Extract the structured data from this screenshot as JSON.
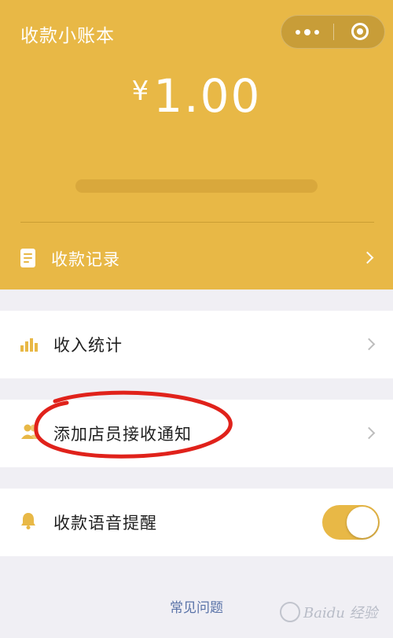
{
  "app": {
    "title": "收款小账本"
  },
  "header": {
    "currency_symbol": "¥",
    "amount": "1.00",
    "records_label": "收款记录"
  },
  "menu": {
    "income_stats": "收入统计",
    "add_clerk_notify": "添加店员接收通知",
    "voice_reminder": "收款语音提醒",
    "voice_reminder_on": true
  },
  "footer": {
    "faq": "常见问题",
    "watermark": "Baidu 经验"
  },
  "colors": {
    "brand": "#e8b846",
    "background": "#f0eff4",
    "link": "#5a73a8",
    "annotation": "#e0221b"
  }
}
